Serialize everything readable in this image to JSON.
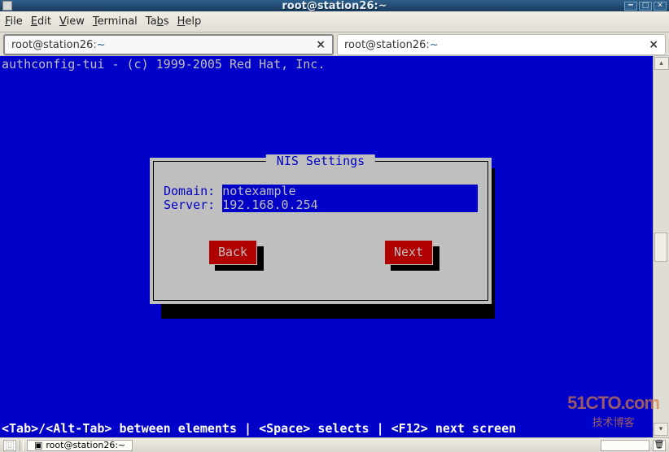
{
  "window": {
    "title": "root@station26:~"
  },
  "menubar": [
    {
      "mnemonic": "F",
      "rest": "ile"
    },
    {
      "mnemonic": "E",
      "rest": "dit"
    },
    {
      "mnemonic": "V",
      "rest": "iew"
    },
    {
      "mnemonic": "T",
      "rest": "erminal"
    },
    {
      "mnemonic": "Ta",
      "rest": "b",
      "rest2": "s"
    },
    {
      "mnemonic": "H",
      "rest": "elp"
    }
  ],
  "tabs": [
    {
      "prefix": "root@station26",
      "path": ":~",
      "active": true
    },
    {
      "prefix": "root@station26",
      "path": ":~",
      "active": false
    }
  ],
  "terminal": {
    "header": "authconfig-tui - (c) 1999-2005 Red Hat, Inc.",
    "footer": " <Tab>/<Alt-Tab> between elements   |   <Space> selects   |  <F12> next screen"
  },
  "dialog": {
    "title": " NIS Settings ",
    "fields": {
      "domain_label": "Domain: ",
      "domain_value": "notexample",
      "server_label": "Server: ",
      "server_value": "192.168.0.254"
    },
    "back_label": "Back",
    "next_label": "Next"
  },
  "taskbar": {
    "task_label": "root@station26:~"
  },
  "watermark": {
    "line1": "51CTO.com",
    "line2": "技术博客"
  }
}
